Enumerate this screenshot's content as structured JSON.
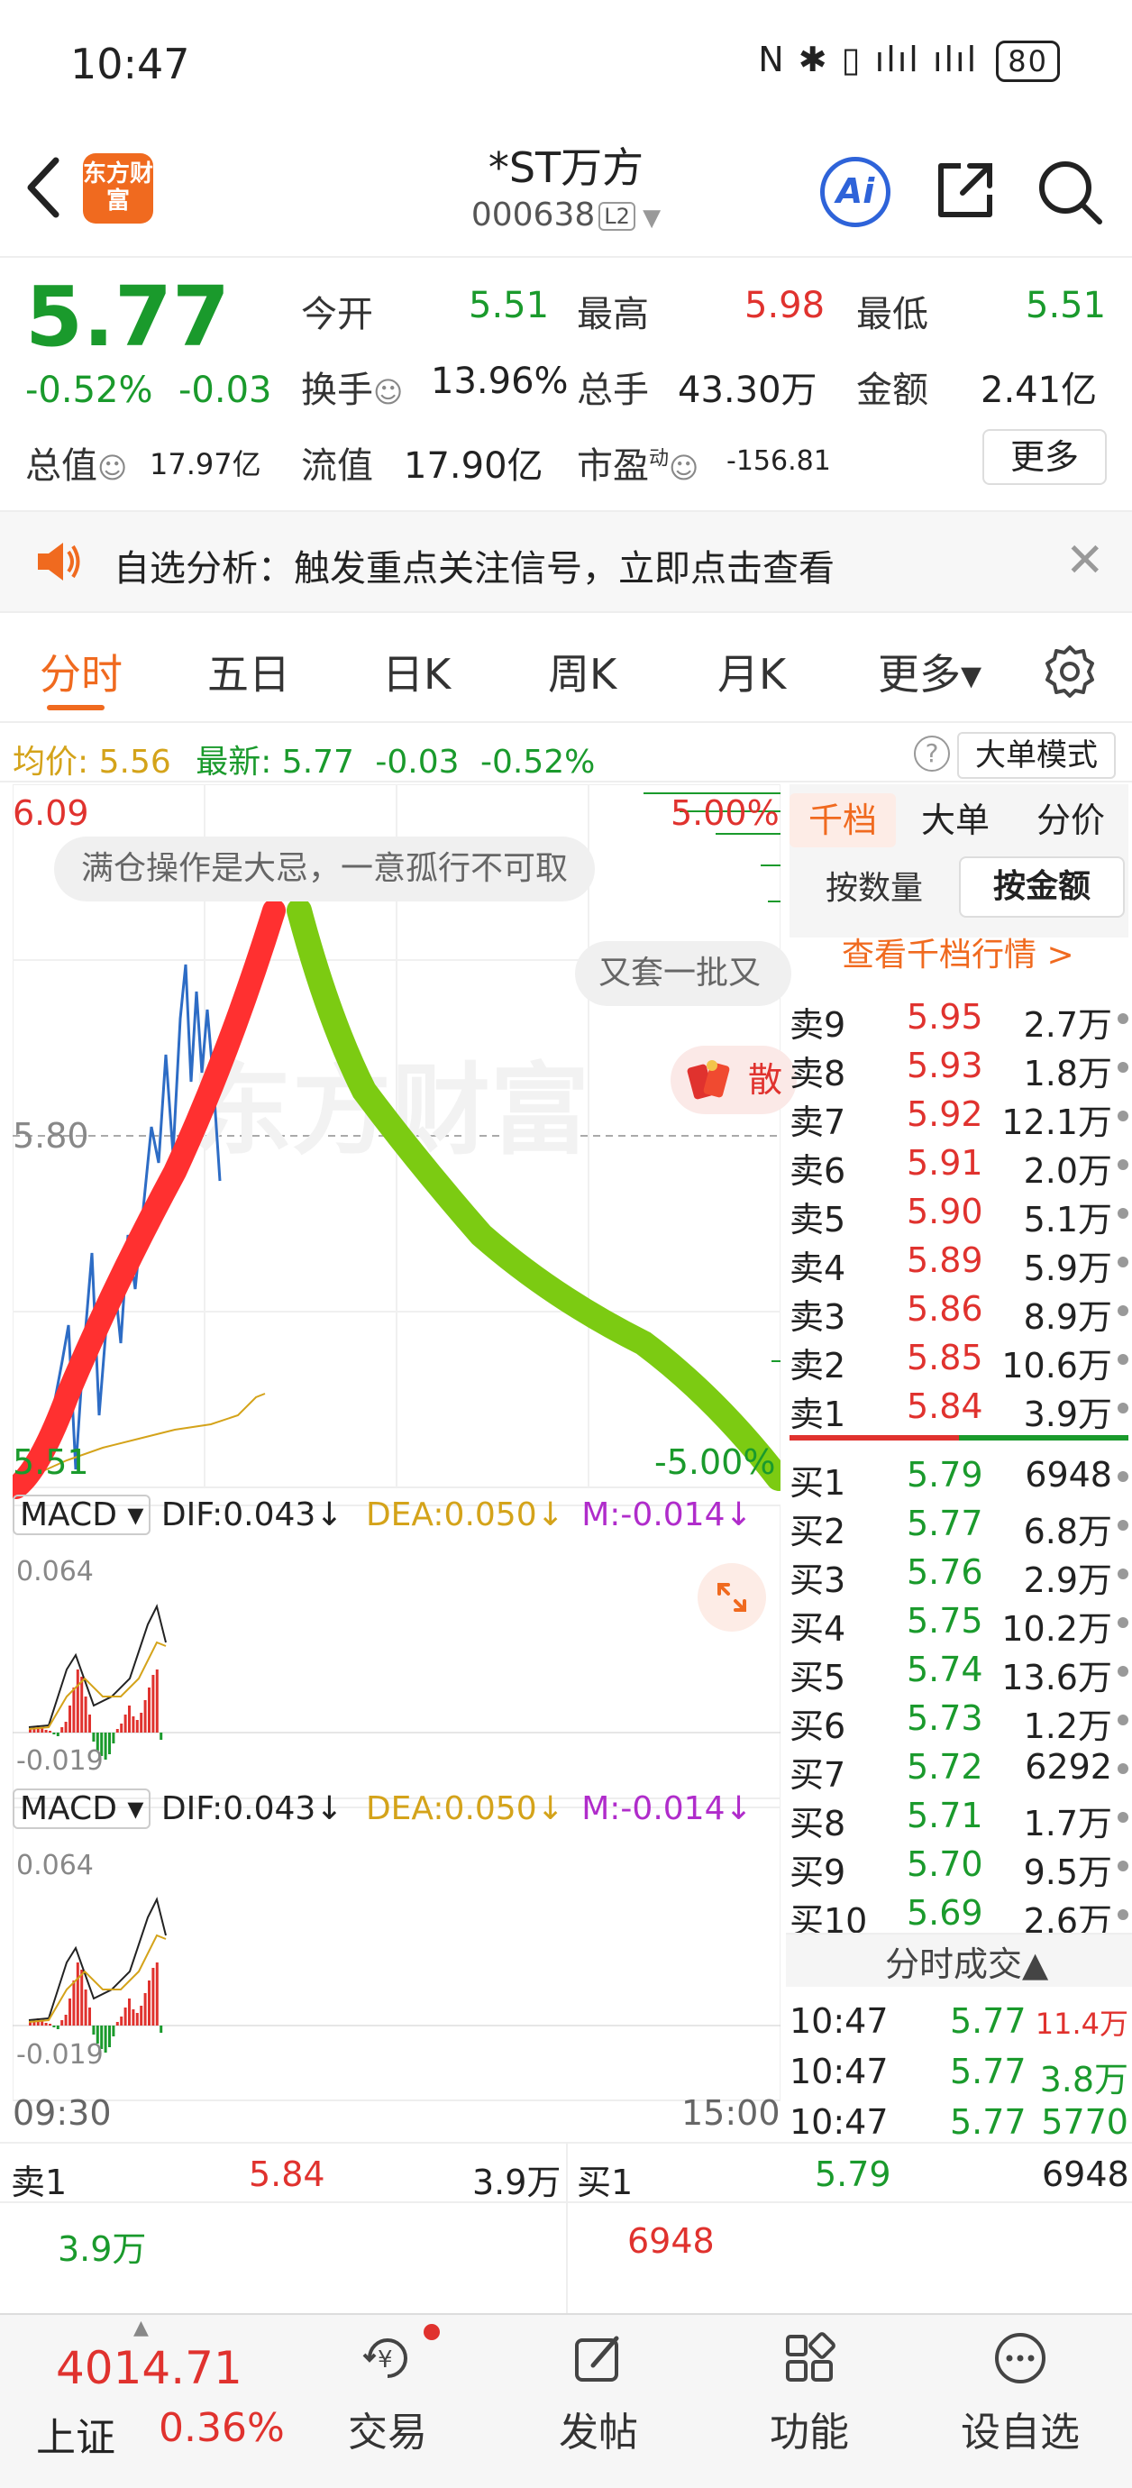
{
  "status_bar": {
    "time": "10:47",
    "icons": "N ✱ ▯ ılıl ılıl",
    "battery": "80"
  },
  "header": {
    "logo_text": "东方财富",
    "stock_name": "*ST万方",
    "stock_code": "000638",
    "level_badge": "L2",
    "icons": [
      "back-icon",
      "ai-icon",
      "share-icon",
      "search-icon"
    ],
    "ai_label": "Ai"
  },
  "quote": {
    "price": "5.77",
    "change_pct": "-0.52%",
    "change": "-0.03",
    "open_label": "今开",
    "open": "5.51",
    "high_label": "最高",
    "high": "5.98",
    "low_label": "最低",
    "low": "5.51",
    "turnover_label": "换手",
    "turnover": "13.96%",
    "volume_label": "总手",
    "volume": "43.30万",
    "amount_label": "金额",
    "amount": "2.41亿",
    "mktcap_label": "总值",
    "mktcap": "17.97亿",
    "float_label": "流值",
    "float": "17.90亿",
    "pe_label": "市盈",
    "pe_sup": "动",
    "pe": "-156.81",
    "more_label": "更多"
  },
  "banner": {
    "text": "自选分析：触发重点关注信号，立即点击查看",
    "close": "✕"
  },
  "tabs": [
    {
      "label": "分时"
    },
    {
      "label": "五日"
    },
    {
      "label": "日K"
    },
    {
      "label": "周K"
    },
    {
      "label": "月K"
    },
    {
      "label": "更多▾"
    }
  ],
  "avg_bar": {
    "avg_label": "均价:",
    "avg": "5.56",
    "latest_label": "最新:",
    "latest": "5.77",
    "chg": "-0.03",
    "pct": "-0.52%",
    "help": "?",
    "big_mode": "大单模式"
  },
  "chart": {
    "top_price": "6.09",
    "top_pct": "5.00%",
    "mid_price": "5.80",
    "bottom_price": "5.51",
    "bottom_pct": "-5.00%",
    "tip1": "满仓操作是大忌，一意孤行不可取",
    "tip2": "又套一批又",
    "tip3": "散",
    "watermark": "东方财富",
    "time_start": "09:30",
    "time_end": "15:00",
    "macd1": {
      "name": "MACD",
      "dif": "DIF:0.043↓",
      "dea": "DEA:0.050↓",
      "m": "M:-0.014↓",
      "max": "0.064",
      "min": "-0.019"
    },
    "macd2": {
      "name": "MACD",
      "dif": "DIF:0.043↓",
      "dea": "DEA:0.050↓",
      "m": "M:-0.014↓",
      "max": "0.064",
      "min": "-0.019"
    }
  },
  "orderbook": {
    "tab_active": "千档",
    "tab2": "大单",
    "tab3": "分价",
    "by_qty": "按数量",
    "by_amt": "按金额",
    "link": "查看千档行情 >",
    "asks": [
      {
        "label": "卖9",
        "price": "5.95",
        "vol": "2.7万"
      },
      {
        "label": "卖8",
        "price": "5.93",
        "vol": "1.8万"
      },
      {
        "label": "卖7",
        "price": "5.92",
        "vol": "12.1万"
      },
      {
        "label": "卖6",
        "price": "5.91",
        "vol": "2.0万"
      },
      {
        "label": "卖5",
        "price": "5.90",
        "vol": "5.1万"
      },
      {
        "label": "卖4",
        "price": "5.89",
        "vol": "5.9万"
      },
      {
        "label": "卖3",
        "price": "5.86",
        "vol": "8.9万"
      },
      {
        "label": "卖2",
        "price": "5.85",
        "vol": "10.6万"
      },
      {
        "label": "卖1",
        "price": "5.84",
        "vol": "3.9万"
      }
    ],
    "bids": [
      {
        "label": "买1",
        "price": "5.79",
        "vol": "6948"
      },
      {
        "label": "买2",
        "price": "5.77",
        "vol": "6.8万"
      },
      {
        "label": "买3",
        "price": "5.76",
        "vol": "2.9万"
      },
      {
        "label": "买4",
        "price": "5.75",
        "vol": "10.2万"
      },
      {
        "label": "买5",
        "price": "5.74",
        "vol": "13.6万"
      },
      {
        "label": "买6",
        "price": "5.73",
        "vol": "1.2万"
      },
      {
        "label": "买7",
        "price": "5.72",
        "vol": "6292"
      },
      {
        "label": "买8",
        "price": "5.71",
        "vol": "1.7万"
      },
      {
        "label": "买9",
        "price": "5.70",
        "vol": "9.5万"
      },
      {
        "label": "买10",
        "price": "5.69",
        "vol": "2.6万"
      }
    ],
    "ticks_title": "分时成交▲",
    "ticks": [
      {
        "time": "10:47",
        "price": "5.77",
        "vol": "11.4万"
      },
      {
        "time": "10:47",
        "price": "5.77",
        "vol": "3.8万"
      },
      {
        "time": "10:47",
        "price": "5.77",
        "vol": "5770"
      }
    ]
  },
  "bottom_quote": {
    "sell_label": "卖1",
    "sell_price": "5.84",
    "sell_vol": "3.9万",
    "sell_vol2": "3.9万",
    "buy_label": "买1",
    "buy_price": "5.79",
    "buy_vol": "6948",
    "buy_vol2": "6948"
  },
  "nav": {
    "index_value": "4014.71",
    "index_name": "上证",
    "index_pct": "0.36%",
    "items": [
      {
        "label": "交易"
      },
      {
        "label": "发帖"
      },
      {
        "label": "功能"
      },
      {
        "label": "设自选"
      }
    ]
  },
  "colors": {
    "up": "#e0322e",
    "down": "#1a9a2c",
    "accent": "#f06a1f",
    "avg": "#d4a31a",
    "ai": "#2e63d9"
  }
}
